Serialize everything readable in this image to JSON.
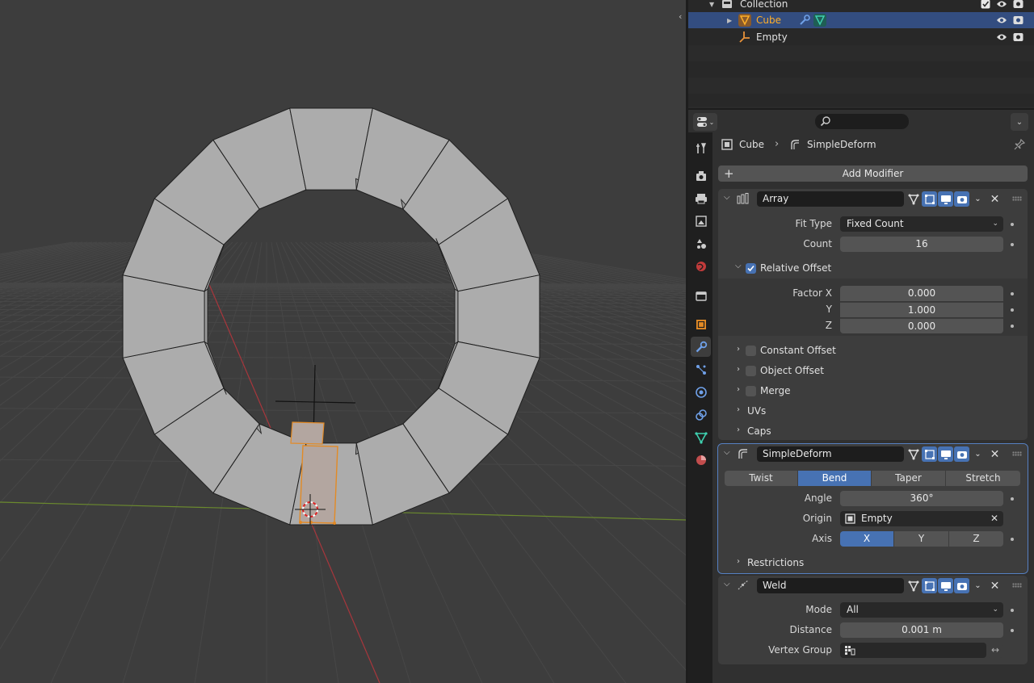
{
  "outliner": {
    "collection_label": "Collection",
    "items": [
      {
        "label": "Cube"
      },
      {
        "label": "Empty"
      }
    ]
  },
  "breadcrumb": {
    "object": "Cube",
    "modifier": "SimpleDeform"
  },
  "add_modifier_label": "Add Modifier",
  "array": {
    "name": "Array",
    "fit_type_label": "Fit Type",
    "fit_type_value": "Fixed Count",
    "count_label": "Count",
    "count_value": "16",
    "relative_offset_label": "Relative Offset",
    "factor_x_label": "Factor X",
    "factor_x": "0.000",
    "y_label": "Y",
    "factor_y": "1.000",
    "z_label": "Z",
    "factor_z": "0.000",
    "constant_offset_label": "Constant Offset",
    "object_offset_label": "Object Offset",
    "merge_label": "Merge",
    "uvs_label": "UVs",
    "caps_label": "Caps"
  },
  "simple_deform": {
    "name": "SimpleDeform",
    "modes": [
      "Twist",
      "Bend",
      "Taper",
      "Stretch"
    ],
    "active_mode": "Bend",
    "angle_label": "Angle",
    "angle_value": "360°",
    "origin_label": "Origin",
    "origin_value": "Empty",
    "axis_label": "Axis",
    "axes": [
      "X",
      "Y",
      "Z"
    ],
    "active_axis": "X",
    "restrictions_label": "Restrictions"
  },
  "weld": {
    "name": "Weld",
    "mode_label": "Mode",
    "mode_value": "All",
    "distance_label": "Distance",
    "distance_value": "0.001 m",
    "vertex_group_label": "Vertex Group",
    "vertex_group_value": ""
  },
  "colors": {
    "selection": "#334d80",
    "accent": "#4772b3",
    "active_object": "#ffaf29",
    "mesh": "#a9a9a9"
  }
}
